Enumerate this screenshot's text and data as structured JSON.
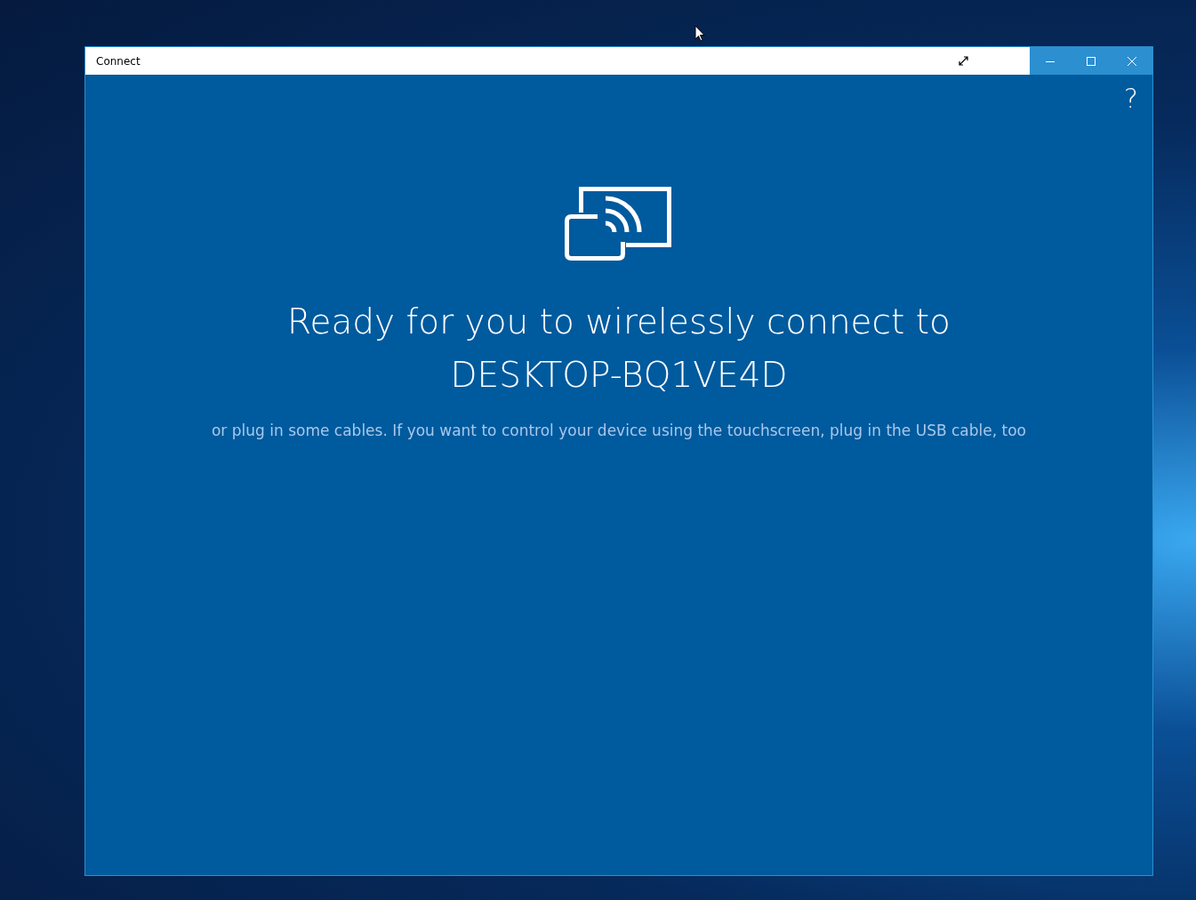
{
  "window": {
    "title": "Connect"
  },
  "help": {
    "label": "?"
  },
  "heading": {
    "line_1": "Ready for you to wirelessly connect to",
    "line_2": "DESKTOP-BQ1VE4D"
  },
  "hint": "or plug in some cables. If you want to control your device using the touchscreen, plug in the USB cable, too"
}
